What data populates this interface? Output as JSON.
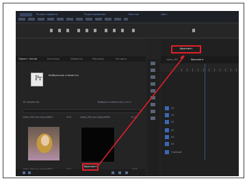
{
  "menubar": {
    "items": [
      "Ролики эффекта",
      "Редактирование",
      "Монтаж",
      "Цвет"
    ]
  },
  "project_panel": {
    "tabs": [
      "Проект: Salute",
      "Источник",
      "Эффекты",
      "Маркеры",
      "История"
    ],
    "active_tab": "Проект: Salute",
    "title": "Выбранные элементы",
    "bin_label": "16 элементов",
    "zoom_label": "Выбрано элементов: 2 из 3",
    "clip1_name": "video_HD.mov Gaynet001",
    "clip1_dur": "4:21",
    "clip2_name": "video_HD.mov Gaynet002",
    "clip2_dur": "12:11",
    "footer_clip1": "video_HD.mov Gaynet001",
    "footer_clip1_dur": "4:21",
    "highlight_label": "Фрагмент",
    "footer_count": "3:04"
  },
  "timeline": {
    "tabs": [
      "video_HD",
      "Фрагмент"
    ],
    "active_tab": "Фрагмент",
    "tracks": [
      "V3",
      "V2",
      "V1",
      "A1",
      "A2",
      "A3",
      "Главный"
    ]
  },
  "colors": {
    "highlight": "#e0202a",
    "accent": "#3c67b7"
  },
  "icons": [
    "file-icon",
    "search-icon",
    "play-icon",
    "arrow-tool-icon",
    "razor-tool-icon",
    "hand-tool-icon",
    "zoom-tool-icon"
  ]
}
